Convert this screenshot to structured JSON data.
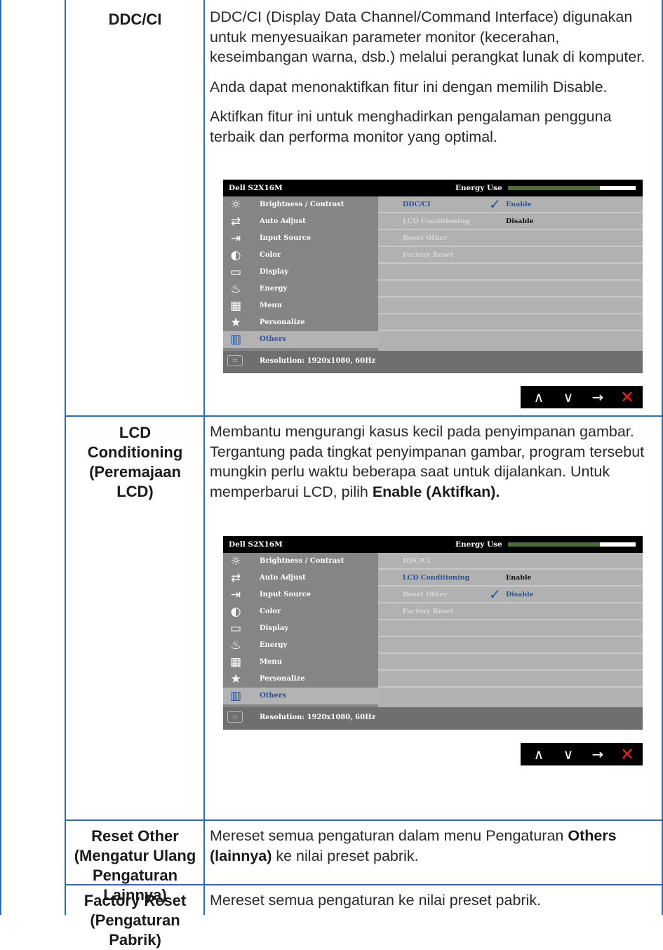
{
  "rows": [
    {
      "label": "DDC/CI",
      "paragraphs": [
        "DDC/CI (Display Data Channel/Command Interface) digunakan untuk menyesuaikan parameter monitor (kecerahan, keseimbangan warna, dsb.) melalui perangkat lunak di komputer.",
        "Anda dapat menonaktifkan fitur ini dengan memilih Disable.",
        "Aktifkan fitur ini untuk menghadirkan pengalaman pengguna terbaik dan performa monitor yang optimal."
      ]
    },
    {
      "label_lines": [
        "LCD",
        "Conditioning",
        "(Peremajaan",
        "LCD)"
      ],
      "text_pre": "Membantu mengurangi kasus kecil pada penyimpanan gambar. Tergantung pada tingkat penyimpanan gambar, program tersebut mungkin perlu waktu beberapa saat untuk dijalankan. Untuk memperbarui LCD, pilih ",
      "text_bold": "Enable (Aktifkan)."
    },
    {
      "label_lines": [
        "Reset Other",
        "(Mengatur Ulang",
        "Pengaturan",
        "Lainnya)"
      ],
      "text_pre": "Mereset semua pengaturan dalam menu Pengaturan ",
      "text_bold": "Others (lainnya)",
      "text_post": " ke nilai preset pabrik."
    },
    {
      "label_lines": [
        "Factory Reset",
        "(Pengaturan",
        "Pabrik)"
      ],
      "text": "Mereset semua pengaturan ke nilai preset pabrik."
    }
  ],
  "osd": {
    "title": "Dell S2X16M",
    "energy_label": "Energy Use",
    "energy_level": 0.72,
    "menu": [
      {
        "label": "Brightness / Contrast",
        "icon": "brightness-icon"
      },
      {
        "label": "Auto Adjust",
        "icon": "auto-adjust-icon"
      },
      {
        "label": "Input Source",
        "icon": "input-source-icon"
      },
      {
        "label": "Color",
        "icon": "color-icon"
      },
      {
        "label": "Display",
        "icon": "display-icon"
      },
      {
        "label": "Energy",
        "icon": "energy-icon"
      },
      {
        "label": "Menu",
        "icon": "menu-icon"
      },
      {
        "label": "Personalize",
        "icon": "star-icon"
      },
      {
        "label": "Others",
        "icon": "others-icon"
      }
    ],
    "resolution": "Resolution: 1920x1080, 60Hz",
    "sub_items": [
      "DDC/CI",
      "LCD Conditioning",
      "Reset Other",
      "Factory Reset"
    ],
    "enable": "Enable",
    "disable": "Disable",
    "nav": [
      "up-arrow-icon",
      "down-arrow-icon",
      "right-arrow-icon",
      "close-icon"
    ]
  }
}
